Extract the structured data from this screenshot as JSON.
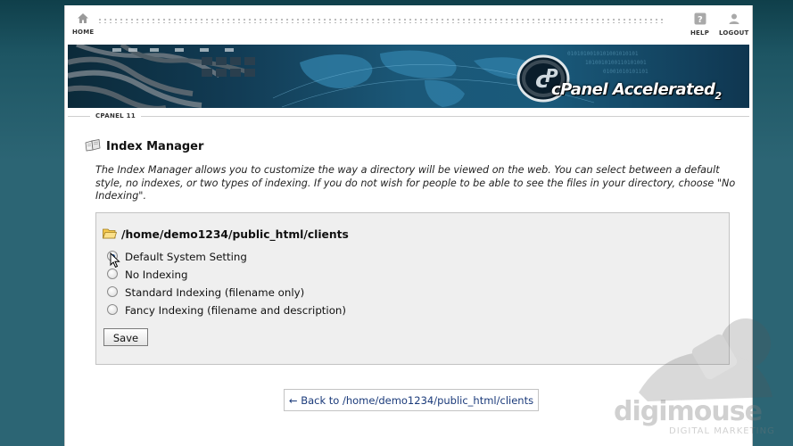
{
  "nav": {
    "home_label": "HOME",
    "help_label": "HELP",
    "logout_label": "LOGOUT"
  },
  "banner": {
    "logo_main": "cPanel",
    "logo_accel": "Accelerated",
    "logo_version": "2"
  },
  "breadcrumb": {
    "label": "CPANEL 11"
  },
  "page": {
    "title": "Index Manager",
    "description": "The Index Manager allows you to customize the way a directory will be viewed on the web. You can select between a default style, no indexes, or two types of indexing. If you do not wish for people to be able to see the files in your directory, choose \"No Indexing\"."
  },
  "form": {
    "directory": "/home/demo1234/public_html/clients",
    "options": [
      {
        "label": "Default System Setting",
        "selected": true
      },
      {
        "label": "No Indexing",
        "selected": false
      },
      {
        "label": "Standard Indexing (filename only)",
        "selected": false
      },
      {
        "label": "Fancy Indexing (filename and description)",
        "selected": false
      }
    ],
    "save_label": "Save"
  },
  "back_link": {
    "label": "← Back to /home/demo1234/public_html/clients"
  },
  "watermark": {
    "brand": "digimouse",
    "tagline": "DIGITAL MARKETING"
  },
  "colors": {
    "background": "#2c6574",
    "accent": "#1a3a7a"
  }
}
